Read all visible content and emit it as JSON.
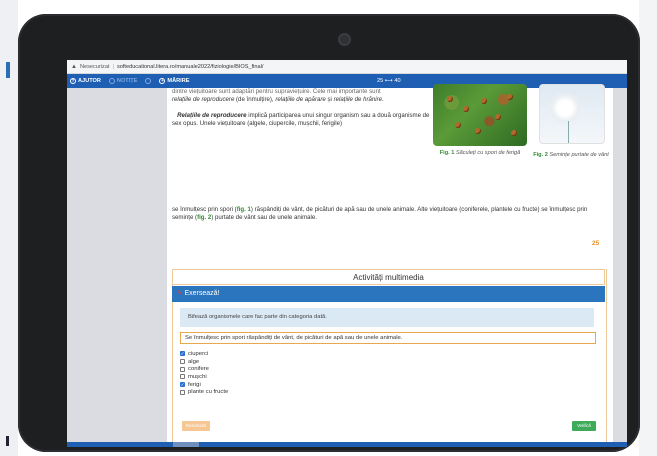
{
  "browser": {
    "warning_text": "Nesecurizat",
    "separator": "|",
    "url": "softeducational.litera.ro/manuale2022/fiziologie/BIOS_final/"
  },
  "toolbar": {
    "help_label": "AJUTOR",
    "notes_label": "NOTIȚE",
    "zoom_label": "MĂRIRE",
    "pages_label": "25 ⟷ 40"
  },
  "content": {
    "para_cut_line": "dintre viețuitoare sunt adaptări pentru supraviețuire. Cele mai importante sunt",
    "para_line2_a": "relațiile de reproducere",
    "para_line2_b": " (de înmulțire), ",
    "para_line2_c": "relațiile de apărare",
    "para_line2_d": " și ",
    "para_line2_e": "relațiile de hrănire",
    "para_line2_f": ".",
    "para3_bold": "Relațiile de reproducere",
    "para3_rest": " implică participarea unui singur organism sau a două organisme de sex opus. Unele viețuitoare (algele, ciupercile, mușchii, ferigile)",
    "para4_a": "se înmulțesc prin spori (",
    "para4_fig1": "fig. 1",
    "para4_b": ") răspândiți de vânt, de picături de apă sau de unele animale. Alte viețuitoare (coniferele, plantele cu fructe) se înmulțesc prin semințe (",
    "para4_fig2": "fig. 2",
    "para4_c": ") purtate de vânt sau de unele animale.",
    "fig1_num": "Fig. 1",
    "fig1_text": "Săculeți cu spori de ferigă",
    "fig2_num": "Fig. 2",
    "fig2_text": "Semințe purtate de vânt",
    "page_number": "25"
  },
  "exercise": {
    "section_title": "Activități multimedia",
    "header_label": "Exersează!",
    "instruction": "Bifează organismele care fac parte din categoria dată.",
    "question": "Se înmulțesc prin spori răspândiți de vânt, de picături de apă sau de unele animale.",
    "options": [
      {
        "label": "ciuperci",
        "checked": true
      },
      {
        "label": "alge",
        "checked": false
      },
      {
        "label": "conifere",
        "checked": false
      },
      {
        "label": "mușchi",
        "checked": false
      },
      {
        "label": "ferigi",
        "checked": true
      },
      {
        "label": "plante cu fructe",
        "checked": false
      }
    ],
    "reset_label": "Resetează",
    "check_label": "Verifică"
  },
  "colors": {
    "toolbar_blue": "#1f5fb3",
    "exercise_blue": "#2b74be",
    "accent_orange": "#e8932a",
    "check_green": "#3faa5a",
    "figure_green": "#2f8a2f"
  }
}
